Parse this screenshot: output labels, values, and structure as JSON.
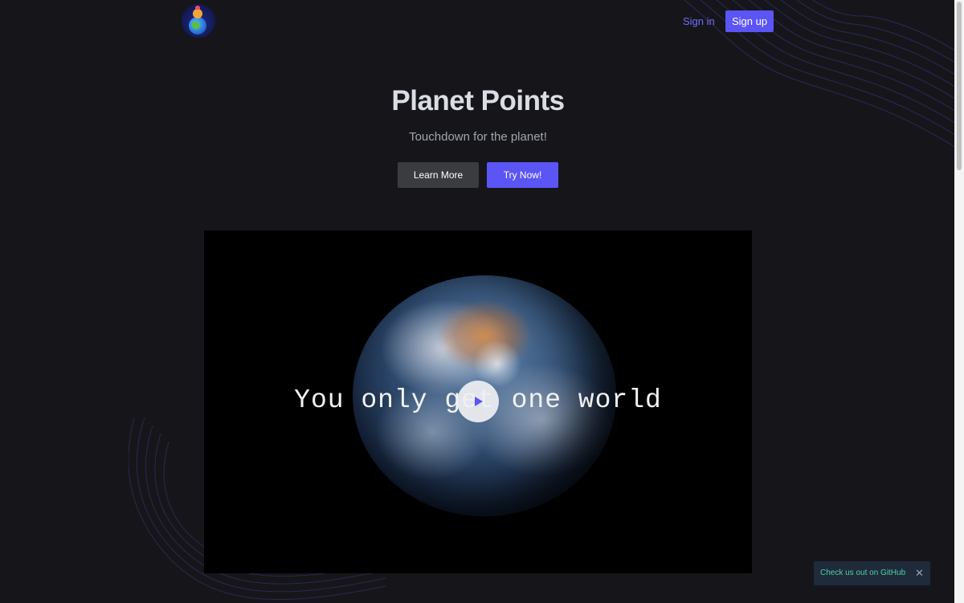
{
  "header": {
    "logo_icon": "planet-points-logo",
    "signin_label": "Sign in",
    "signup_label": "Sign up"
  },
  "hero": {
    "title": "Planet Points",
    "subtitle": "Touchdown for the planet!",
    "learn_more_label": "Learn More",
    "try_now_label": "Try Now!"
  },
  "video": {
    "caption": "You only get one world",
    "play_icon": "play-icon"
  },
  "toast": {
    "text": "Check us out on GitHub",
    "close_label": "✕"
  },
  "colors": {
    "background": "#16161a",
    "accent": "#5b55f5",
    "link": "#6f6cff",
    "toast_text": "#4fd1a5"
  }
}
